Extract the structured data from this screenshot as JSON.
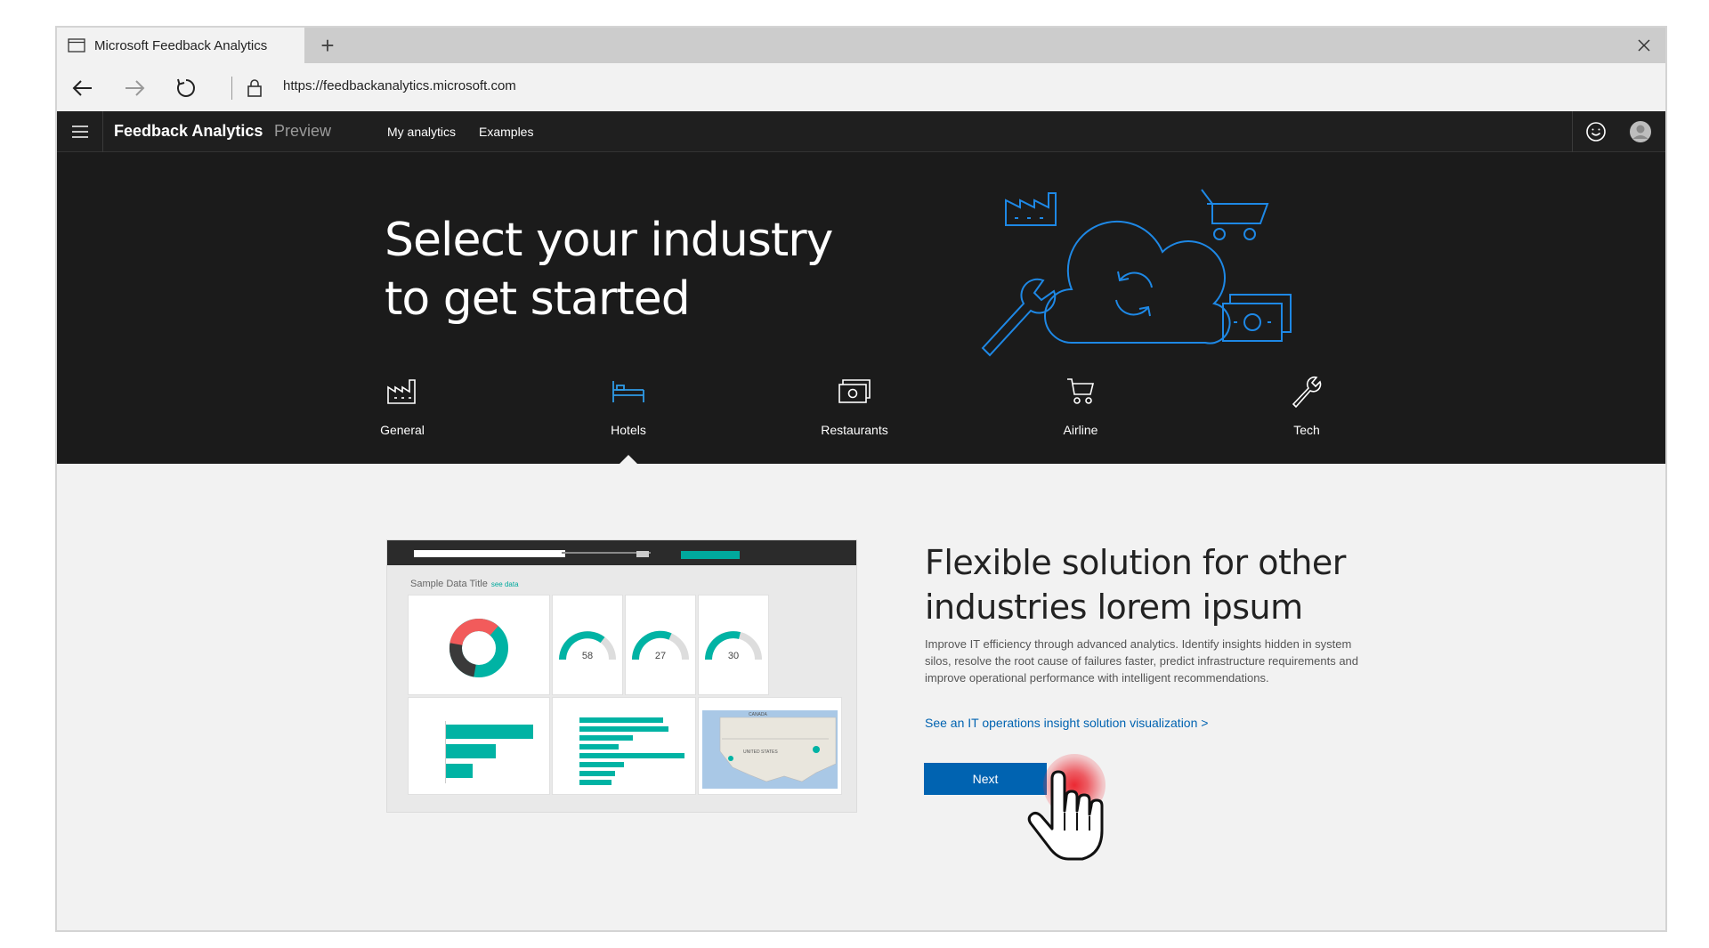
{
  "browser": {
    "tab_title": "Microsoft Feedback Analytics",
    "new_tab": "+",
    "url": "https://feedbackanalytics.microsoft.com"
  },
  "app": {
    "brand": "Feedback Analytics",
    "preview": "Preview",
    "nav": [
      "My analytics",
      "Examples"
    ]
  },
  "hero": {
    "title": "Select your industry to get started",
    "industries": [
      {
        "label": "General",
        "icon": "factory-icon",
        "selected": false
      },
      {
        "label": "Hotels",
        "icon": "bed-icon",
        "selected": true
      },
      {
        "label": "Restaurants",
        "icon": "money-icon",
        "selected": false
      },
      {
        "label": "Airline",
        "icon": "cart-icon",
        "selected": false
      },
      {
        "label": "Tech",
        "icon": "wrench-icon",
        "selected": false
      }
    ]
  },
  "preview_dashboard": {
    "title": "Sample Data Title",
    "link": "see data",
    "gauges": [
      "58",
      "27",
      "30"
    ],
    "map_labels": [
      "CANADA",
      "UNITED STATES"
    ]
  },
  "solution": {
    "title": "Flexible solution for other industries lorem ipsum",
    "body": "Improve IT efficiency through advanced analytics. Identify insights hidden in system silos, resolve the root cause of failures faster, predict infrastructure requirements and improve operational performance with intelligent recommendations.",
    "link": "See an IT operations insight solution visualization  >",
    "next": "Next"
  },
  "colors": {
    "accent": "#0063b1",
    "hero_line": "#1e88e5",
    "teal": "#00b3a4",
    "selected_icon": "#2f9be6"
  }
}
